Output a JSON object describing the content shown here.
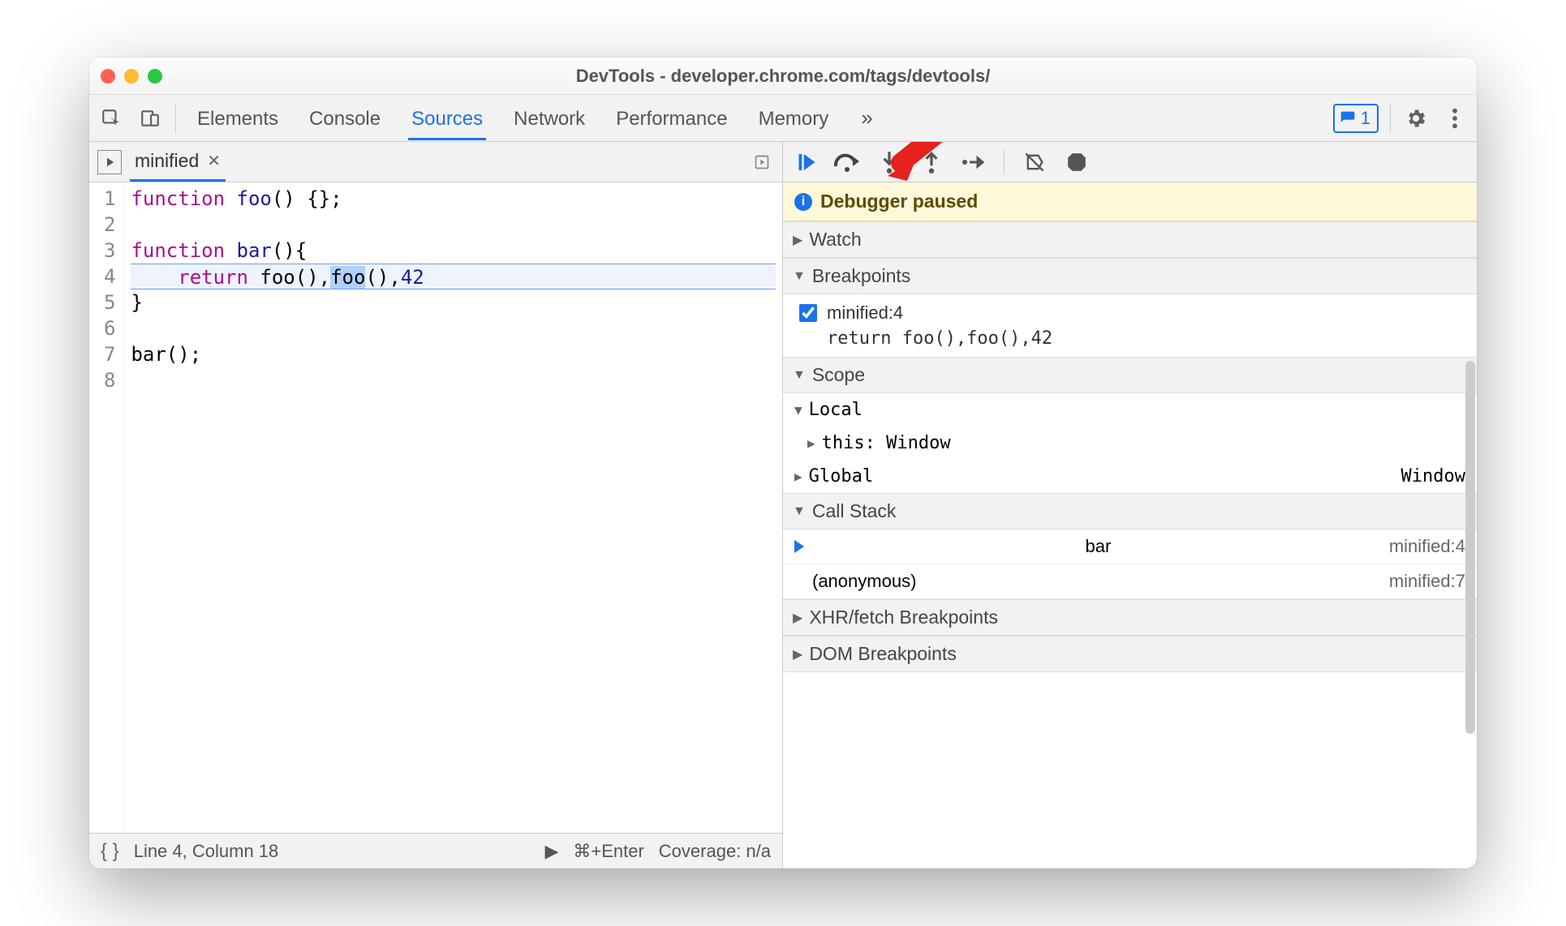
{
  "window": {
    "title": "DevTools - developer.chrome.com/tags/devtools/"
  },
  "toolbar": {
    "tabs": [
      "Elements",
      "Console",
      "Sources",
      "Network",
      "Performance",
      "Memory"
    ],
    "active_tab": "Sources",
    "issues_count": "1"
  },
  "file": {
    "name": "minified"
  },
  "code": {
    "lines": [
      {
        "n": "1",
        "html": "<span class='kw-func'>function</span> <span class='kw-name'>foo</span>() {};"
      },
      {
        "n": "2",
        "html": ""
      },
      {
        "n": "3",
        "html": "<span class='kw-func'>function</span> <span class='kw-name'>bar</span>(){"
      },
      {
        "n": "4",
        "html": "    <span class='kw-ret'>return</span> foo(),<span class='token-hl'>foo</span>(),<span class='num'>42</span>",
        "bp": true
      },
      {
        "n": "5",
        "html": "}"
      },
      {
        "n": "6",
        "html": ""
      },
      {
        "n": "7",
        "html": "bar();"
      },
      {
        "n": "8",
        "html": ""
      }
    ]
  },
  "status": {
    "position": "Line 4, Column 18",
    "run_hint": "⌘+Enter",
    "coverage": "Coverage: n/a"
  },
  "debugger": {
    "paused_label": "Debugger paused",
    "sections": {
      "watch": "Watch",
      "breakpoints": "Breakpoints",
      "scope": "Scope",
      "callstack": "Call Stack",
      "xhr": "XHR/fetch Breakpoints",
      "dom": "DOM Breakpoints"
    },
    "breakpoint": {
      "location": "minified:4",
      "code": "return foo(),foo(),42"
    },
    "scope": {
      "local_label": "Local",
      "this_label": "this",
      "this_value": "Window",
      "global_label": "Global",
      "global_value": "Window"
    },
    "callstack": [
      {
        "name": "bar",
        "loc": "minified:4",
        "active": true
      },
      {
        "name": "(anonymous)",
        "loc": "minified:7",
        "active": false
      }
    ]
  }
}
